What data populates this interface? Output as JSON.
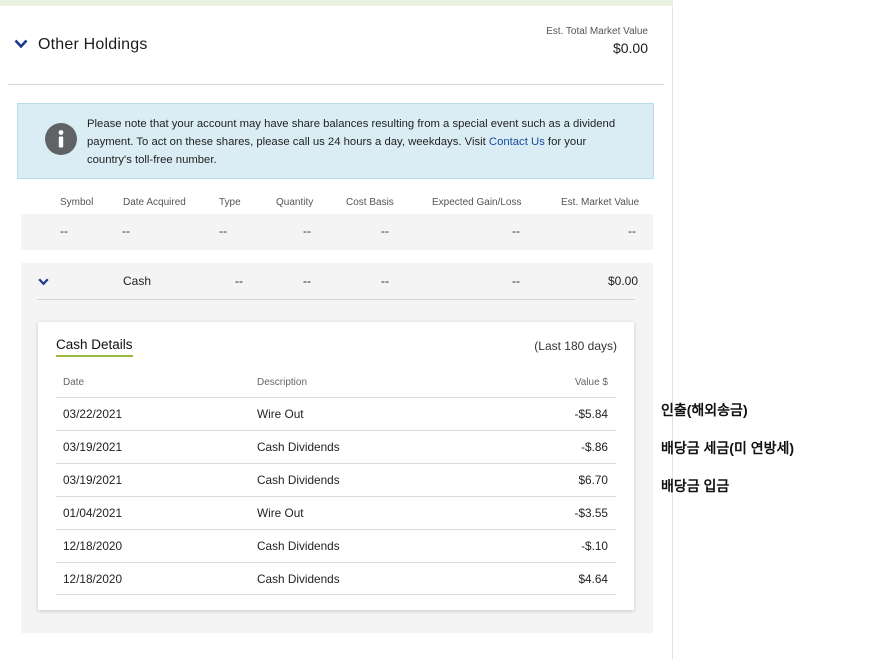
{
  "header": {
    "title": "Other Holdings",
    "est_label": "Est. Total Market Value",
    "est_value": "$0.00"
  },
  "notice": {
    "text_before": "Please note that your account may have share balances resulting from a special event such as a dividend payment. To act on these shares, please call us 24 hours a day, weekdays. Visit ",
    "link": "Contact Us",
    "text_after": " for your country's toll-free number.",
    "icon": "info-icon"
  },
  "columns": [
    "Symbol",
    "Date Acquired",
    "Type",
    "Quantity",
    "Cost Basis",
    "Expected Gain/Loss",
    "Est. Market Value"
  ],
  "empty_row": [
    "--",
    "--",
    "--",
    "--",
    "--",
    "--",
    "--"
  ],
  "cash_row": {
    "name": "Cash",
    "type": "--",
    "quantity": "--",
    "cost_basis": "--",
    "gain_loss": "--",
    "market_value": "$0.00"
  },
  "cash_details": {
    "title": "Cash Details",
    "range": "(Last 180 days)",
    "headers": {
      "date": "Date",
      "description": "Description",
      "value": "Value $"
    },
    "rows": [
      {
        "date": "03/22/2021",
        "description": "Wire Out",
        "value": "-$5.84"
      },
      {
        "date": "03/19/2021",
        "description": "Cash Dividends",
        "value": "-$.86"
      },
      {
        "date": "03/19/2021",
        "description": "Cash Dividends",
        "value": "$6.70"
      },
      {
        "date": "01/04/2021",
        "description": "Wire Out",
        "value": "-$3.55"
      },
      {
        "date": "12/18/2020",
        "description": "Cash Dividends",
        "value": "-$.10"
      },
      {
        "date": "12/18/2020",
        "description": "Cash Dividends",
        "value": "$4.64"
      }
    ]
  },
  "annotations": [
    "인출(해외송금)",
    "배당금 세금(미 연방세)",
    "배당금 입금"
  ]
}
